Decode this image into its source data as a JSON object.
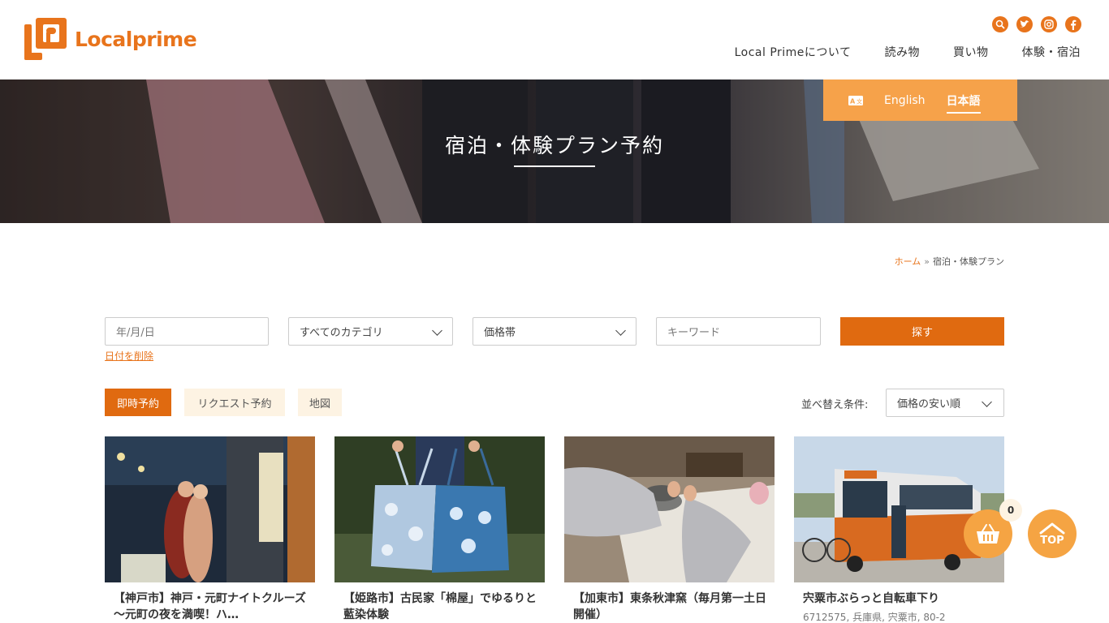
{
  "header": {
    "logo_text": "Localprime",
    "social": [
      {
        "icon": "search-icon"
      },
      {
        "icon": "twitter-icon"
      },
      {
        "icon": "instagram-icon"
      },
      {
        "icon": "facebook-icon"
      }
    ],
    "nav": [
      "Local Primeについて",
      "読み物",
      "買い物",
      "体験・宿泊"
    ]
  },
  "hero": {
    "title": "宿泊・体験プラン予約"
  },
  "language": {
    "icon": "translate-icon",
    "options": [
      "English",
      "日本語"
    ],
    "active": "日本語"
  },
  "breadcrumb": {
    "home": "ホーム",
    "separator": "»",
    "current": "宿泊・体験プラン"
  },
  "filters": {
    "date_placeholder": "年/月/日",
    "clear_date": "日付を削除",
    "category": "すべてのカテゴリ",
    "price": "価格帯",
    "keyword_placeholder": "キーワード",
    "search_button": "探す"
  },
  "tabs": {
    "instant": "即時予約",
    "request": "リクエスト予約",
    "map": "地図"
  },
  "sort": {
    "label": "並べ替え条件:",
    "value": "価格の安い順"
  },
  "cards": [
    {
      "title": "【神戸市】神戸・元町ナイトクルーズ　～元町の夜を満喫！ハ…",
      "address": ""
    },
    {
      "title": "【姫路市】古民家「棉屋」でゆるりと藍染体験",
      "address": ""
    },
    {
      "title": "【加東市】東条秋津窯（毎月第一土日開催）",
      "address": ""
    },
    {
      "title": "宍粟市ぶらっと自転車下り",
      "address": "6712575, 兵庫県, 宍粟市, 80-2"
    }
  ],
  "cart": {
    "count": "0",
    "icon": "basket-icon"
  },
  "totop": {
    "label": "TOP"
  },
  "colors": {
    "brand": "#e8741c",
    "accent_light": "#f5a443",
    "tab_inactive": "#fdf3e3"
  }
}
